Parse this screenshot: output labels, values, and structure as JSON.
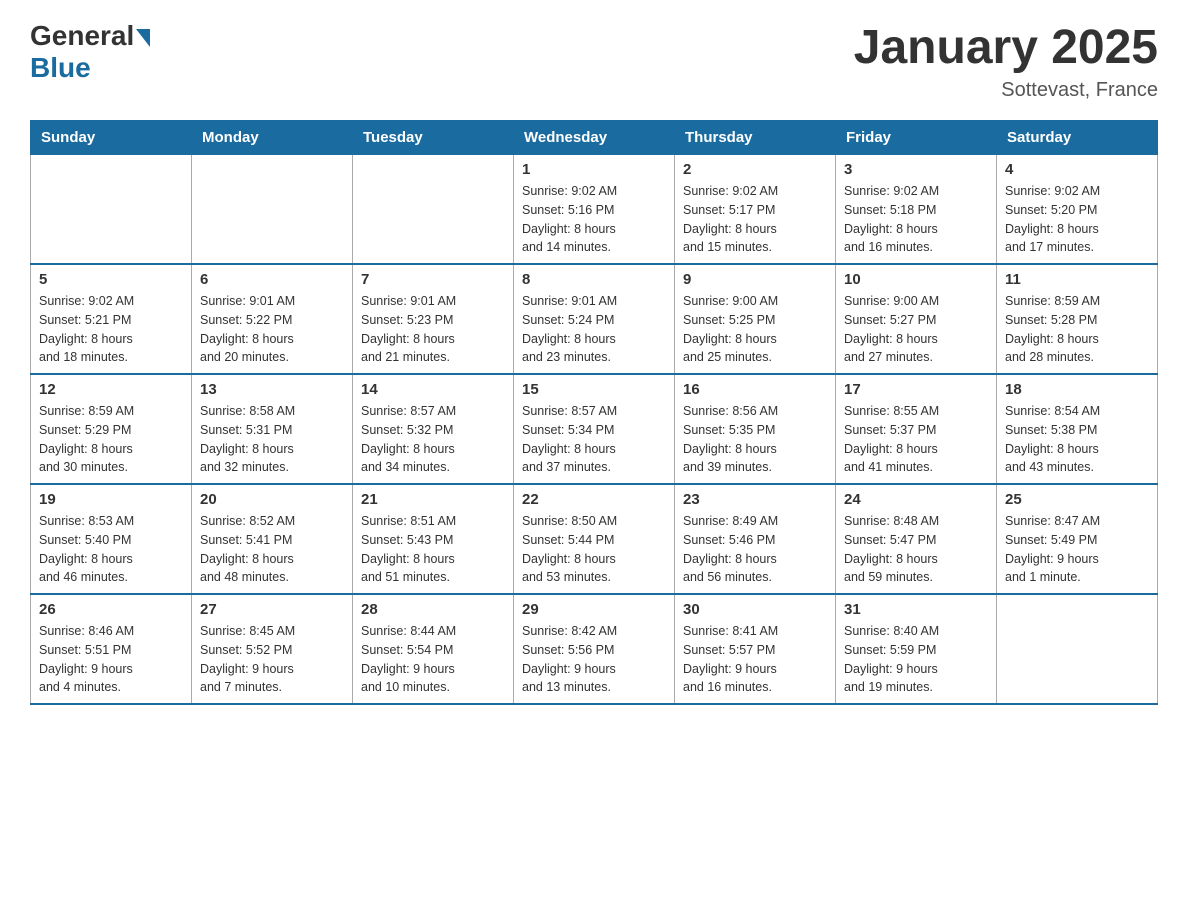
{
  "logo": {
    "general": "General",
    "blue": "Blue"
  },
  "title": "January 2025",
  "subtitle": "Sottevast, France",
  "headers": [
    "Sunday",
    "Monday",
    "Tuesday",
    "Wednesday",
    "Thursday",
    "Friday",
    "Saturday"
  ],
  "weeks": [
    [
      {
        "day": "",
        "info": ""
      },
      {
        "day": "",
        "info": ""
      },
      {
        "day": "",
        "info": ""
      },
      {
        "day": "1",
        "info": "Sunrise: 9:02 AM\nSunset: 5:16 PM\nDaylight: 8 hours\nand 14 minutes."
      },
      {
        "day": "2",
        "info": "Sunrise: 9:02 AM\nSunset: 5:17 PM\nDaylight: 8 hours\nand 15 minutes."
      },
      {
        "day": "3",
        "info": "Sunrise: 9:02 AM\nSunset: 5:18 PM\nDaylight: 8 hours\nand 16 minutes."
      },
      {
        "day": "4",
        "info": "Sunrise: 9:02 AM\nSunset: 5:20 PM\nDaylight: 8 hours\nand 17 minutes."
      }
    ],
    [
      {
        "day": "5",
        "info": "Sunrise: 9:02 AM\nSunset: 5:21 PM\nDaylight: 8 hours\nand 18 minutes."
      },
      {
        "day": "6",
        "info": "Sunrise: 9:01 AM\nSunset: 5:22 PM\nDaylight: 8 hours\nand 20 minutes."
      },
      {
        "day": "7",
        "info": "Sunrise: 9:01 AM\nSunset: 5:23 PM\nDaylight: 8 hours\nand 21 minutes."
      },
      {
        "day": "8",
        "info": "Sunrise: 9:01 AM\nSunset: 5:24 PM\nDaylight: 8 hours\nand 23 minutes."
      },
      {
        "day": "9",
        "info": "Sunrise: 9:00 AM\nSunset: 5:25 PM\nDaylight: 8 hours\nand 25 minutes."
      },
      {
        "day": "10",
        "info": "Sunrise: 9:00 AM\nSunset: 5:27 PM\nDaylight: 8 hours\nand 27 minutes."
      },
      {
        "day": "11",
        "info": "Sunrise: 8:59 AM\nSunset: 5:28 PM\nDaylight: 8 hours\nand 28 minutes."
      }
    ],
    [
      {
        "day": "12",
        "info": "Sunrise: 8:59 AM\nSunset: 5:29 PM\nDaylight: 8 hours\nand 30 minutes."
      },
      {
        "day": "13",
        "info": "Sunrise: 8:58 AM\nSunset: 5:31 PM\nDaylight: 8 hours\nand 32 minutes."
      },
      {
        "day": "14",
        "info": "Sunrise: 8:57 AM\nSunset: 5:32 PM\nDaylight: 8 hours\nand 34 minutes."
      },
      {
        "day": "15",
        "info": "Sunrise: 8:57 AM\nSunset: 5:34 PM\nDaylight: 8 hours\nand 37 minutes."
      },
      {
        "day": "16",
        "info": "Sunrise: 8:56 AM\nSunset: 5:35 PM\nDaylight: 8 hours\nand 39 minutes."
      },
      {
        "day": "17",
        "info": "Sunrise: 8:55 AM\nSunset: 5:37 PM\nDaylight: 8 hours\nand 41 minutes."
      },
      {
        "day": "18",
        "info": "Sunrise: 8:54 AM\nSunset: 5:38 PM\nDaylight: 8 hours\nand 43 minutes."
      }
    ],
    [
      {
        "day": "19",
        "info": "Sunrise: 8:53 AM\nSunset: 5:40 PM\nDaylight: 8 hours\nand 46 minutes."
      },
      {
        "day": "20",
        "info": "Sunrise: 8:52 AM\nSunset: 5:41 PM\nDaylight: 8 hours\nand 48 minutes."
      },
      {
        "day": "21",
        "info": "Sunrise: 8:51 AM\nSunset: 5:43 PM\nDaylight: 8 hours\nand 51 minutes."
      },
      {
        "day": "22",
        "info": "Sunrise: 8:50 AM\nSunset: 5:44 PM\nDaylight: 8 hours\nand 53 minutes."
      },
      {
        "day": "23",
        "info": "Sunrise: 8:49 AM\nSunset: 5:46 PM\nDaylight: 8 hours\nand 56 minutes."
      },
      {
        "day": "24",
        "info": "Sunrise: 8:48 AM\nSunset: 5:47 PM\nDaylight: 8 hours\nand 59 minutes."
      },
      {
        "day": "25",
        "info": "Sunrise: 8:47 AM\nSunset: 5:49 PM\nDaylight: 9 hours\nand 1 minute."
      }
    ],
    [
      {
        "day": "26",
        "info": "Sunrise: 8:46 AM\nSunset: 5:51 PM\nDaylight: 9 hours\nand 4 minutes."
      },
      {
        "day": "27",
        "info": "Sunrise: 8:45 AM\nSunset: 5:52 PM\nDaylight: 9 hours\nand 7 minutes."
      },
      {
        "day": "28",
        "info": "Sunrise: 8:44 AM\nSunset: 5:54 PM\nDaylight: 9 hours\nand 10 minutes."
      },
      {
        "day": "29",
        "info": "Sunrise: 8:42 AM\nSunset: 5:56 PM\nDaylight: 9 hours\nand 13 minutes."
      },
      {
        "day": "30",
        "info": "Sunrise: 8:41 AM\nSunset: 5:57 PM\nDaylight: 9 hours\nand 16 minutes."
      },
      {
        "day": "31",
        "info": "Sunrise: 8:40 AM\nSunset: 5:59 PM\nDaylight: 9 hours\nand 19 minutes."
      },
      {
        "day": "",
        "info": ""
      }
    ]
  ]
}
